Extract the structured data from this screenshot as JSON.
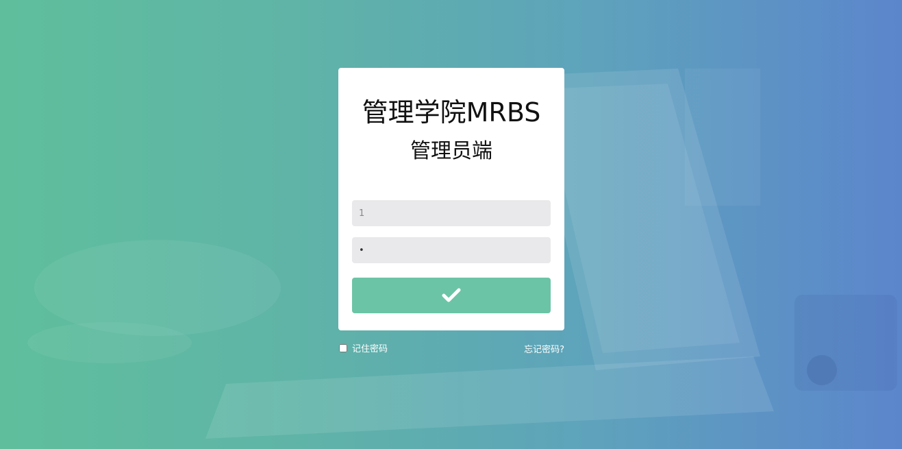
{
  "login": {
    "title": "管理学院MRBS",
    "subtitle": "管理员端",
    "username_value": "1",
    "password_value": "•",
    "submit_icon": "check-icon"
  },
  "options": {
    "remember_label": "记住密码",
    "forgot_label": "忘记密码?"
  },
  "colors": {
    "gradient_start": "#5fbf9c",
    "gradient_end": "#5c86cc",
    "submit_button": "#6bc4a6",
    "input_bg": "#e9e9eb"
  }
}
